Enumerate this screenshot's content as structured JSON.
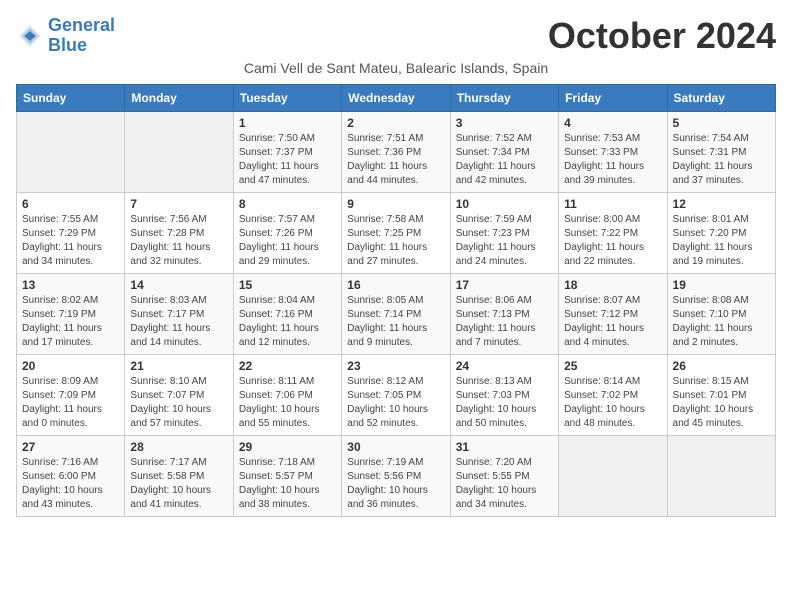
{
  "logo": {
    "line1": "General",
    "line2": "Blue"
  },
  "title": "October 2024",
  "subtitle": "Cami Vell de Sant Mateu, Balearic Islands, Spain",
  "days_of_week": [
    "Sunday",
    "Monday",
    "Tuesday",
    "Wednesday",
    "Thursday",
    "Friday",
    "Saturday"
  ],
  "weeks": [
    [
      {
        "day": "",
        "detail": ""
      },
      {
        "day": "",
        "detail": ""
      },
      {
        "day": "1",
        "detail": "Sunrise: 7:50 AM\nSunset: 7:37 PM\nDaylight: 11 hours and 47 minutes."
      },
      {
        "day": "2",
        "detail": "Sunrise: 7:51 AM\nSunset: 7:36 PM\nDaylight: 11 hours and 44 minutes."
      },
      {
        "day": "3",
        "detail": "Sunrise: 7:52 AM\nSunset: 7:34 PM\nDaylight: 11 hours and 42 minutes."
      },
      {
        "day": "4",
        "detail": "Sunrise: 7:53 AM\nSunset: 7:33 PM\nDaylight: 11 hours and 39 minutes."
      },
      {
        "day": "5",
        "detail": "Sunrise: 7:54 AM\nSunset: 7:31 PM\nDaylight: 11 hours and 37 minutes."
      }
    ],
    [
      {
        "day": "6",
        "detail": "Sunrise: 7:55 AM\nSunset: 7:29 PM\nDaylight: 11 hours and 34 minutes."
      },
      {
        "day": "7",
        "detail": "Sunrise: 7:56 AM\nSunset: 7:28 PM\nDaylight: 11 hours and 32 minutes."
      },
      {
        "day": "8",
        "detail": "Sunrise: 7:57 AM\nSunset: 7:26 PM\nDaylight: 11 hours and 29 minutes."
      },
      {
        "day": "9",
        "detail": "Sunrise: 7:58 AM\nSunset: 7:25 PM\nDaylight: 11 hours and 27 minutes."
      },
      {
        "day": "10",
        "detail": "Sunrise: 7:59 AM\nSunset: 7:23 PM\nDaylight: 11 hours and 24 minutes."
      },
      {
        "day": "11",
        "detail": "Sunrise: 8:00 AM\nSunset: 7:22 PM\nDaylight: 11 hours and 22 minutes."
      },
      {
        "day": "12",
        "detail": "Sunrise: 8:01 AM\nSunset: 7:20 PM\nDaylight: 11 hours and 19 minutes."
      }
    ],
    [
      {
        "day": "13",
        "detail": "Sunrise: 8:02 AM\nSunset: 7:19 PM\nDaylight: 11 hours and 17 minutes."
      },
      {
        "day": "14",
        "detail": "Sunrise: 8:03 AM\nSunset: 7:17 PM\nDaylight: 11 hours and 14 minutes."
      },
      {
        "day": "15",
        "detail": "Sunrise: 8:04 AM\nSunset: 7:16 PM\nDaylight: 11 hours and 12 minutes."
      },
      {
        "day": "16",
        "detail": "Sunrise: 8:05 AM\nSunset: 7:14 PM\nDaylight: 11 hours and 9 minutes."
      },
      {
        "day": "17",
        "detail": "Sunrise: 8:06 AM\nSunset: 7:13 PM\nDaylight: 11 hours and 7 minutes."
      },
      {
        "day": "18",
        "detail": "Sunrise: 8:07 AM\nSunset: 7:12 PM\nDaylight: 11 hours and 4 minutes."
      },
      {
        "day": "19",
        "detail": "Sunrise: 8:08 AM\nSunset: 7:10 PM\nDaylight: 11 hours and 2 minutes."
      }
    ],
    [
      {
        "day": "20",
        "detail": "Sunrise: 8:09 AM\nSunset: 7:09 PM\nDaylight: 11 hours and 0 minutes."
      },
      {
        "day": "21",
        "detail": "Sunrise: 8:10 AM\nSunset: 7:07 PM\nDaylight: 10 hours and 57 minutes."
      },
      {
        "day": "22",
        "detail": "Sunrise: 8:11 AM\nSunset: 7:06 PM\nDaylight: 10 hours and 55 minutes."
      },
      {
        "day": "23",
        "detail": "Sunrise: 8:12 AM\nSunset: 7:05 PM\nDaylight: 10 hours and 52 minutes."
      },
      {
        "day": "24",
        "detail": "Sunrise: 8:13 AM\nSunset: 7:03 PM\nDaylight: 10 hours and 50 minutes."
      },
      {
        "day": "25",
        "detail": "Sunrise: 8:14 AM\nSunset: 7:02 PM\nDaylight: 10 hours and 48 minutes."
      },
      {
        "day": "26",
        "detail": "Sunrise: 8:15 AM\nSunset: 7:01 PM\nDaylight: 10 hours and 45 minutes."
      }
    ],
    [
      {
        "day": "27",
        "detail": "Sunrise: 7:16 AM\nSunset: 6:00 PM\nDaylight: 10 hours and 43 minutes."
      },
      {
        "day": "28",
        "detail": "Sunrise: 7:17 AM\nSunset: 5:58 PM\nDaylight: 10 hours and 41 minutes."
      },
      {
        "day": "29",
        "detail": "Sunrise: 7:18 AM\nSunset: 5:57 PM\nDaylight: 10 hours and 38 minutes."
      },
      {
        "day": "30",
        "detail": "Sunrise: 7:19 AM\nSunset: 5:56 PM\nDaylight: 10 hours and 36 minutes."
      },
      {
        "day": "31",
        "detail": "Sunrise: 7:20 AM\nSunset: 5:55 PM\nDaylight: 10 hours and 34 minutes."
      },
      {
        "day": "",
        "detail": ""
      },
      {
        "day": "",
        "detail": ""
      }
    ]
  ]
}
